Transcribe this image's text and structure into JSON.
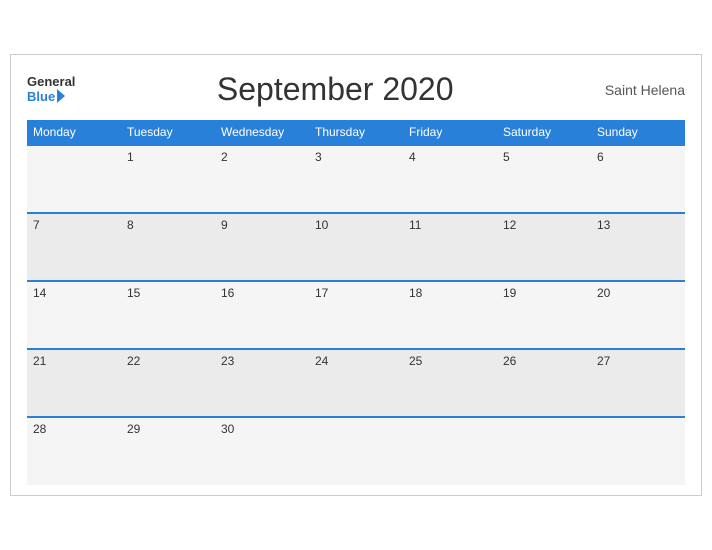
{
  "header": {
    "logo_general": "General",
    "logo_blue": "Blue",
    "title": "September 2020",
    "region": "Saint Helena"
  },
  "days_of_week": [
    "Monday",
    "Tuesday",
    "Wednesday",
    "Thursday",
    "Friday",
    "Saturday",
    "Sunday"
  ],
  "weeks": [
    [
      "",
      "1",
      "2",
      "3",
      "4",
      "5",
      "6"
    ],
    [
      "7",
      "8",
      "9",
      "10",
      "11",
      "12",
      "13"
    ],
    [
      "14",
      "15",
      "16",
      "17",
      "18",
      "19",
      "20"
    ],
    [
      "21",
      "22",
      "23",
      "24",
      "25",
      "26",
      "27"
    ],
    [
      "28",
      "29",
      "30",
      "",
      "",
      "",
      ""
    ]
  ]
}
